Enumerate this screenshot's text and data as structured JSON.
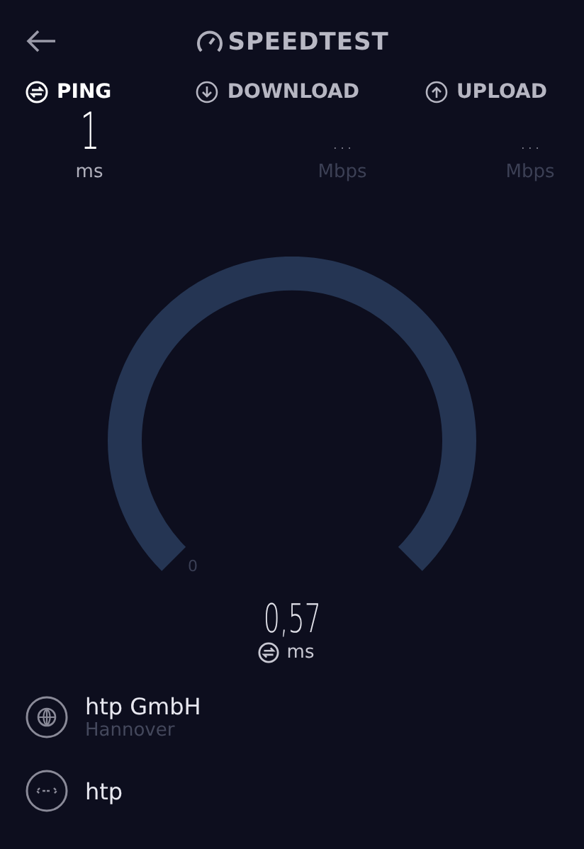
{
  "header": {
    "title": "SPEEDTEST"
  },
  "metrics": [
    {
      "kind": "ping",
      "label": "PING",
      "value": "1",
      "unit": "ms",
      "selected": true
    },
    {
      "kind": "download",
      "label": "DOWNLOAD",
      "value": "...",
      "unit": "Mbps",
      "selected": false
    },
    {
      "kind": "upload",
      "label": "UPLOAD",
      "value": "...",
      "unit": "Mbps",
      "selected": false
    }
  ],
  "gauge": {
    "scale_label": "0",
    "reading": "0,57",
    "unit": "ms"
  },
  "server": [
    {
      "kind": "provider",
      "name": "htp GmbH",
      "location": "Hannover"
    },
    {
      "kind": "connection",
      "name": "htp"
    }
  ]
}
